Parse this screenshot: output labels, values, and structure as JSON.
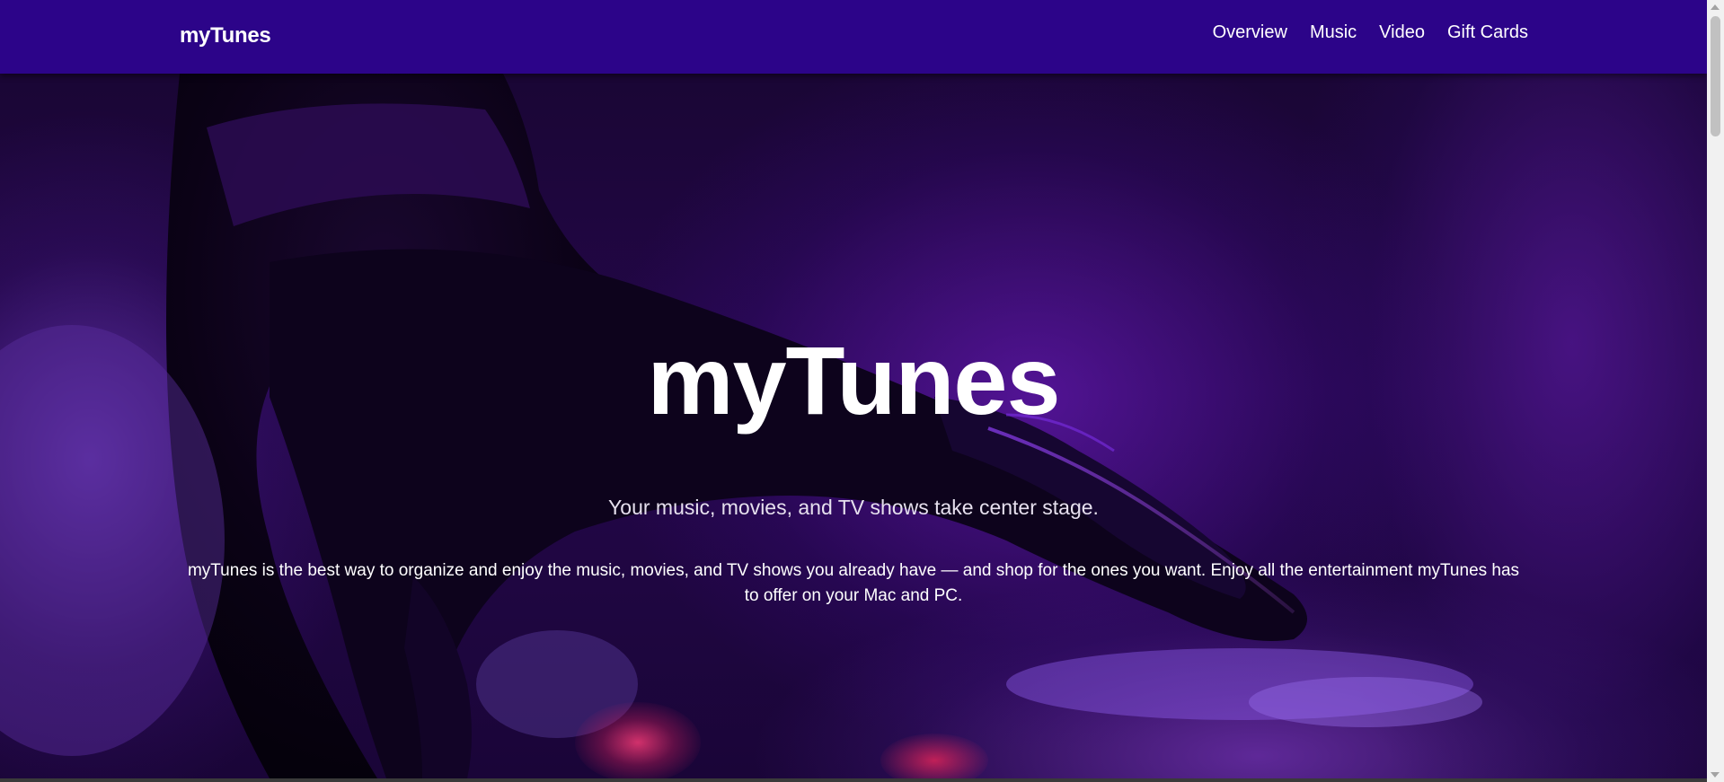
{
  "navbar": {
    "brand": "myTunes",
    "links": [
      "Overview",
      "Music",
      "Video",
      "Gift Cards"
    ]
  },
  "hero": {
    "title": "myTunes",
    "tagline": "Your music, movies, and TV shows take center stage.",
    "description": "myTunes is the best way to organize and enjoy the music, movies, and TV shows you already have — and shop for the ones you want. Enjoy all the entertainment myTunes has to offer on your Mac and PC."
  },
  "colors": {
    "navbar_bg": "#2c0489",
    "text": "#ffffff"
  }
}
